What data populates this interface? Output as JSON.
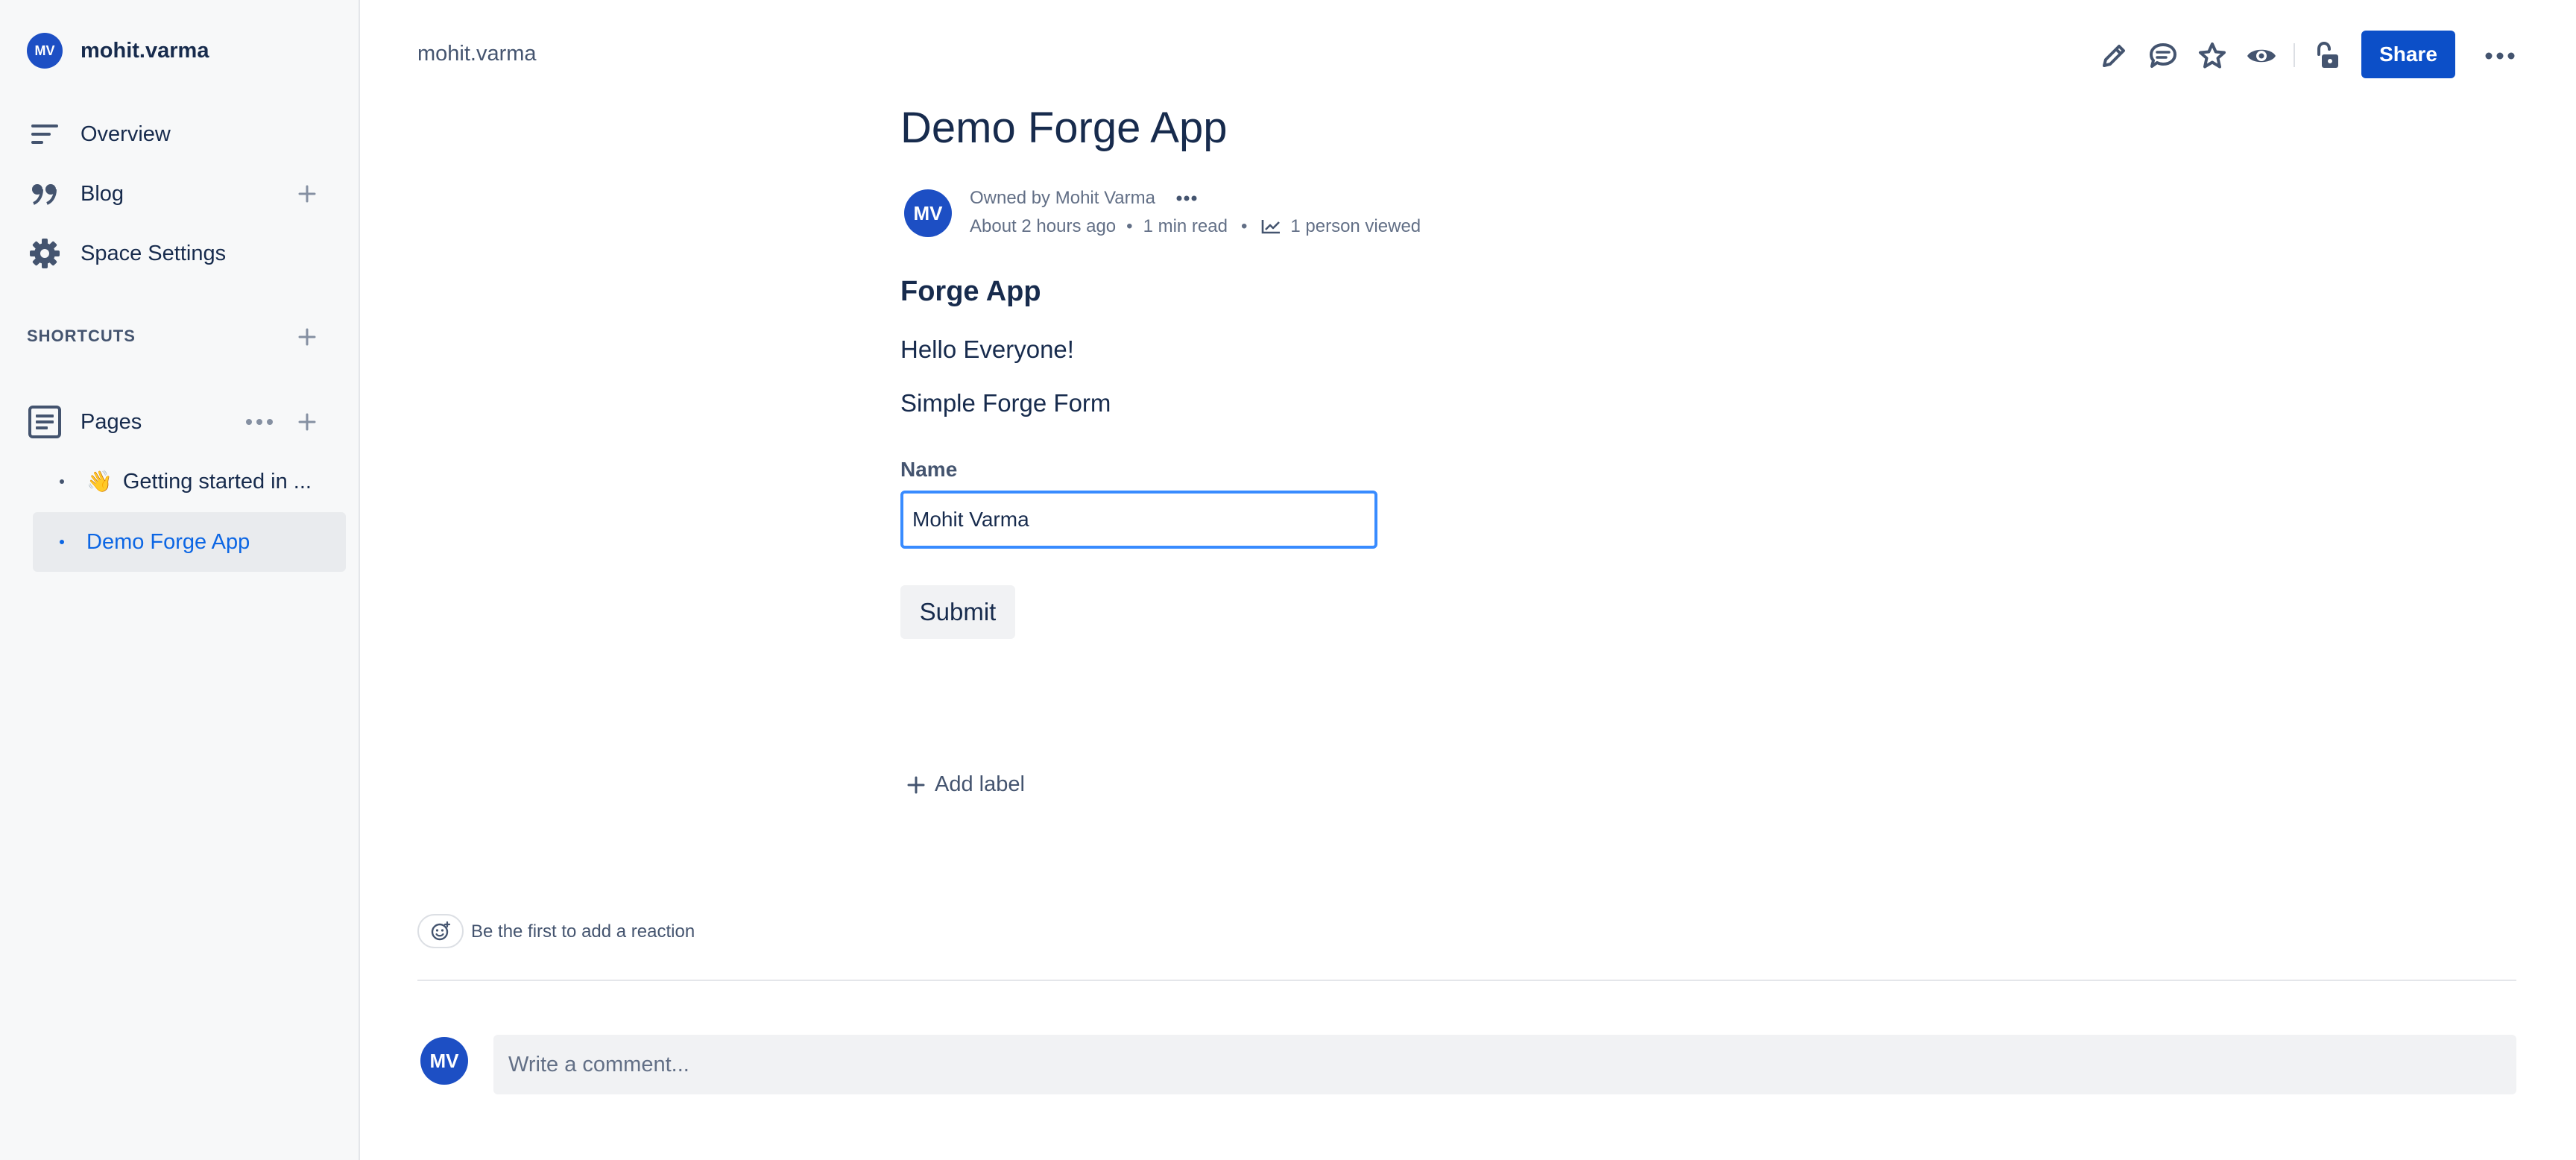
{
  "sidebar": {
    "space": {
      "avatar_initials": "MV",
      "name": "mohit.varma"
    },
    "nav": [
      {
        "label": "Overview",
        "icon": "overview-icon"
      },
      {
        "label": "Blog",
        "icon": "quote-icon"
      },
      {
        "label": "Space Settings",
        "icon": "gear-icon"
      }
    ],
    "shortcuts_title": "SHORTCUTS",
    "pages_label": "Pages",
    "pages": [
      {
        "emoji": "👋",
        "label": "Getting started in ...",
        "active": false
      },
      {
        "label": "Demo Forge App",
        "active": true
      }
    ]
  },
  "header": {
    "breadcrumb": "mohit.varma",
    "share_label": "Share",
    "toolbar_icons": [
      "edit-icon",
      "comment-icon",
      "star-icon",
      "watch-icon",
      "restrictions-icon",
      "more-icon"
    ]
  },
  "page": {
    "title": "Demo Forge App",
    "byline": {
      "avatar_initials": "MV",
      "owner": "Owned by Mohit Varma",
      "time": "About 2 hours ago",
      "read_time": "1 min read",
      "views": "1 person viewed"
    },
    "heading": "Forge App",
    "paragraph1": "Hello Everyone!",
    "paragraph2": "Simple Forge Form",
    "form": {
      "name_label": "Name",
      "name_value": "Mohit Varma",
      "submit_label": "Submit"
    },
    "add_label": "Add label",
    "reaction_text": "Be the first to add a reaction",
    "comment": {
      "avatar_initials": "MV",
      "placeholder": "Write a comment..."
    }
  },
  "colors": {
    "brand": "#0c4fc8",
    "avatar": "#1d4fc4",
    "active_link": "#0c66e4",
    "focus_border": "#388bff"
  }
}
